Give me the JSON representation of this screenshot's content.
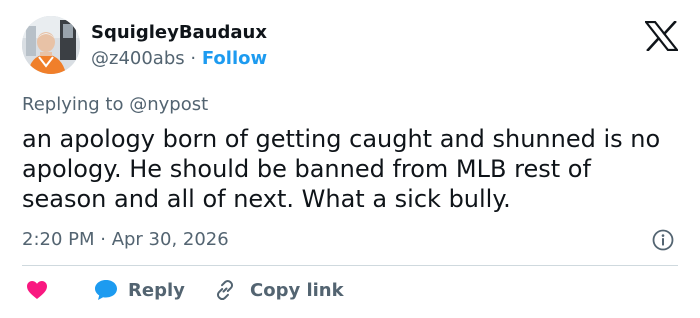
{
  "author": {
    "display_name": "SquigleyBaudaux",
    "handle": "@z400abs",
    "separator": "·",
    "follow_label": "Follow"
  },
  "reply_context": {
    "prefix": "Replying to",
    "mention": "@nypost"
  },
  "tweet": {
    "text": "an apology born of getting caught and shunned is no apology. He should be banned from MLB rest of season and all of next. What a sick bully.",
    "timestamp": "2:20 PM · Apr 30, 2026"
  },
  "actions": {
    "reply_label": "Reply",
    "copy_link_label": "Copy link"
  },
  "colors": {
    "accent": "#1d9bf0",
    "heart": "#f91880",
    "secondary_text": "#536471",
    "primary_text": "#0f1419"
  },
  "icons": {
    "brand": "x-logo-icon",
    "info": "info-icon",
    "like": "heart-icon",
    "reply": "speech-bubble-icon",
    "copy": "link-icon"
  }
}
